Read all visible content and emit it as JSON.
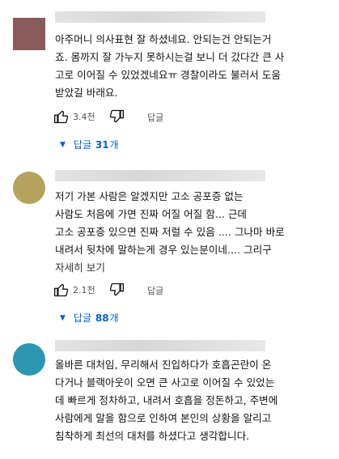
{
  "comments": [
    {
      "text": "아주머니 의사표현 잘 하셨네요. 안되는건 안되는거\n죠. 몸까지 잘 가누지 못하시는걸 보니 더 갔다간 큰 사\n고로 이어질 수 있었겠네요ㅠ 경찰이라도 불러서 도움\n받았길 바래요.",
      "likes": "3.4천",
      "reply_label": "답글",
      "replies_prefix": "답글",
      "replies_count": "31",
      "replies_suffix": "개"
    },
    {
      "text": "저기 가본 사람은 알겠지만 고소 공포증 없는\n사람도 처음에 가면 진짜 어질 어질 함... 근데\n고소 공포증 있으면 진짜 저럴 수 있음 .... 그나마 바로\n내려서 뒷차에 말하는게 경우 있는분이네.... 그리구",
      "more_label": "자세히 보기",
      "likes": "2.1천",
      "reply_label": "답글",
      "replies_prefix": "답글",
      "replies_count": "88",
      "replies_suffix": "개"
    },
    {
      "text": "올바른 대처임, 무리해서 진입하다가 호흡곤란이 온\n다거나 블랙아웃이 오면 큰 사고로 이어질 수 있었는\n데 빠르게 정차하고, 내려서 호흡을 정돈하고, 주변에\n사람에게 말을 함으로 인하여 본인의 상황을 알리고\n침착하게 최선의 대처를 하셨다고 생각합니다."
    }
  ],
  "icons": {
    "like": "thumbs-up-icon",
    "dislike": "thumbs-down-icon",
    "expand": "caret-down-icon"
  },
  "colors": {
    "link": "#065fd4",
    "text": "#121212",
    "meta": "#555555"
  }
}
